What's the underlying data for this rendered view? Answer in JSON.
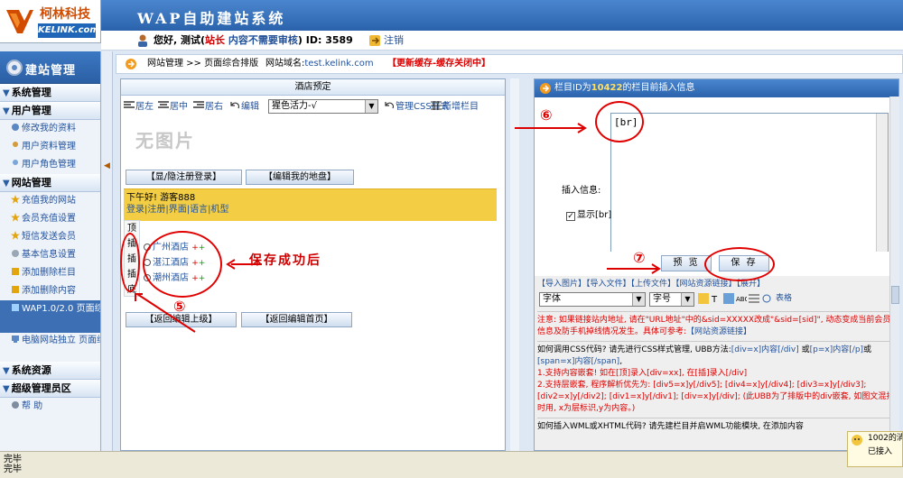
{
  "header": {
    "logo_cn": "柯林科技",
    "logo_en": "KELINK.com",
    "app_title": "WAP自助建站系统"
  },
  "userbar": {
    "greeting": "您好, 测试(",
    "role": "站长",
    "audit": " 内容不需要审核",
    "id_text": ") ID: 3589",
    "logout": "注销"
  },
  "sidebar": {
    "title": "建站管理",
    "sections": [
      {
        "label": "系统管理",
        "items": []
      },
      {
        "label": "用户管理",
        "items": [
          "修改我的资料",
          "用户资料管理",
          "用户角色管理"
        ]
      },
      {
        "label": "网站管理",
        "items": [
          "充值我的网站",
          "会员充值设置",
          "短信发送会员",
          "基本信息设置",
          "添加删除栏目",
          "添加删除内容",
          "WAP1.0/2.0 页面综合排版",
          "电脑网站独立 页面综合排版"
        ]
      },
      {
        "label": "系统资源",
        "items": []
      },
      {
        "label": "超级管理员区",
        "items": [
          "帮 助"
        ]
      }
    ]
  },
  "crumb": {
    "path": "网站管理 >> 页面综合排版",
    "domain_label": "网站域名:",
    "domain_value": "test.kelink.com",
    "refresh": "【更新缓存-缓存关闭中】"
  },
  "left": {
    "title": "酒店预定",
    "toolbar": {
      "left": "居左",
      "center": "居中",
      "right": "居右",
      "edit": "编辑",
      "style_value": "猩色活力-√",
      "manage_css": "管理CSS样式",
      "add_column": "新增栏目"
    },
    "noimage": "无图片",
    "btn_login": "【显/隐注册登录】",
    "btn_edit_home": "【编辑我的地盘】",
    "greet_line1": "下午好!  游客888",
    "greet_line2": "登录|注册|界面|语言|机型",
    "vstack": [
      "顶",
      "插",
      "插",
      "插",
      "底"
    ],
    "hotels": [
      "广州酒店",
      "湛江酒店",
      "潮州酒店"
    ],
    "btn_back_up": "【返回编辑上级】",
    "btn_back_home": "【返回编辑首页】",
    "note": "保存成功后"
  },
  "right": {
    "title_pre": "栏目ID为",
    "title_id": "10422",
    "title_post": "的栏目前插入信息",
    "textarea": "[br]",
    "label_insert": "插入信息:",
    "label_show": "显示[br]",
    "btn_preview": "预 览",
    "btn_save": "保 存",
    "help_links": "【导入图片】【导入文件】【上传文件】【网站资源链接】【展开】",
    "font_select": "字体",
    "size_select": "字号",
    "table_label": "表格",
    "warn": "注意: 如果链接站内地址, 请在\"URL地址\"中的&sid=XXXXX改成\"&sid=[sid]\", 动态变成当前会员信息及防手机掉线情况发生。具体可参考:",
    "warn_link": "【网站资源链接】",
    "css_q": "如何调用CSS代码? 请先进行CSS样式管理, UBB方法:",
    "css_code1": "[div=x]内容[/div]",
    "css_or": "或",
    "css_code2": "[p=x]内容[/p]",
    "css_or2": "或",
    "css_code3": "[span=x]内容[/span]",
    "css_tail": ",",
    "css_1": "1.支持内容嵌套! 如在[顶]录入[div=xx], 在[插]录入[/div]",
    "css_2": "2.支持层嵌套, 程序解析优先为: [div5=x]y[/div5]; [div4=x]y[/div4]; [div3=x]y[/div3]; [div2=x]y[/div2]; [div1=x]y[/div1]; [div=x]y[/div]; (此UBB为了排版中的div嵌套, 如图文混排时用, x为层标识,y为内容。)",
    "wml_q": "如何插入WML或XHTML代码? 请先建栏目并启WML功能模块, 在添加内容"
  },
  "status": {
    "line1": "完毕",
    "line2": "完毕"
  },
  "toast": {
    "line1": "1002的消",
    "line2": "已接入"
  },
  "annotations": {
    "n5": "⑤",
    "n6": "⑥",
    "n7": "⑦"
  },
  "colors": {
    "header_blue": "#2a63ac",
    "accent_red": "#d00000",
    "link_blue": "#23529b",
    "greet_yellow": "#f3ce45"
  }
}
